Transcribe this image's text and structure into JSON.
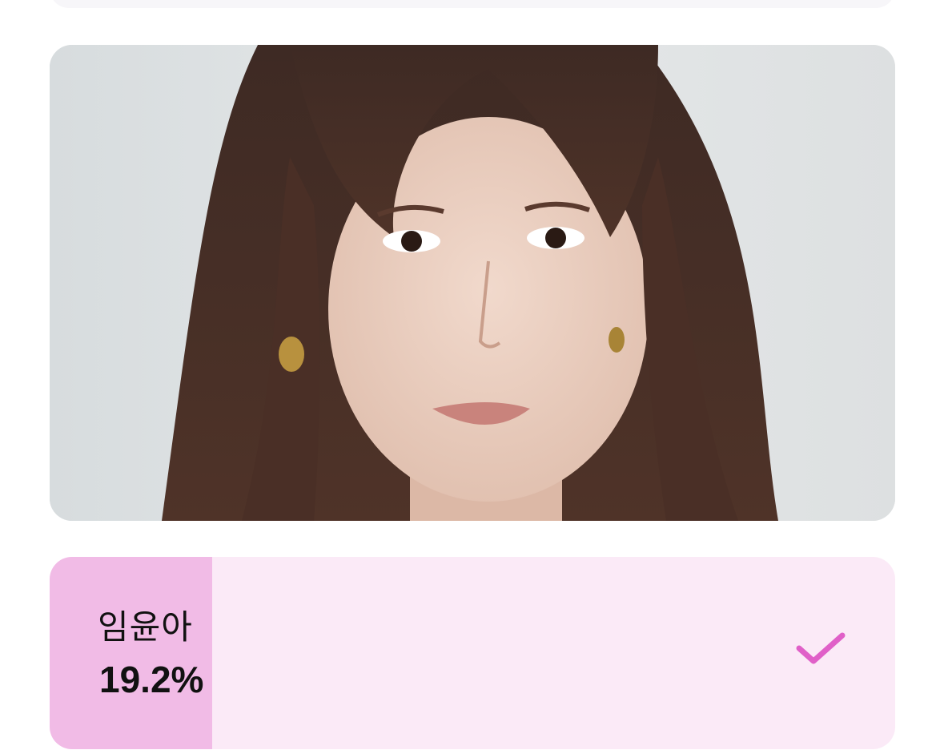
{
  "top_card": {},
  "photo": {
    "subject": "portrait-photo"
  },
  "vote_option": {
    "name": "임윤아",
    "percent_label": "19.2%",
    "percent_value": 19.2,
    "selected": true,
    "check_icon": "checkmark-icon"
  },
  "colors": {
    "option_bg": "#fbeaf7",
    "option_fill": "#f1bbe6",
    "check": "#e060c8"
  }
}
